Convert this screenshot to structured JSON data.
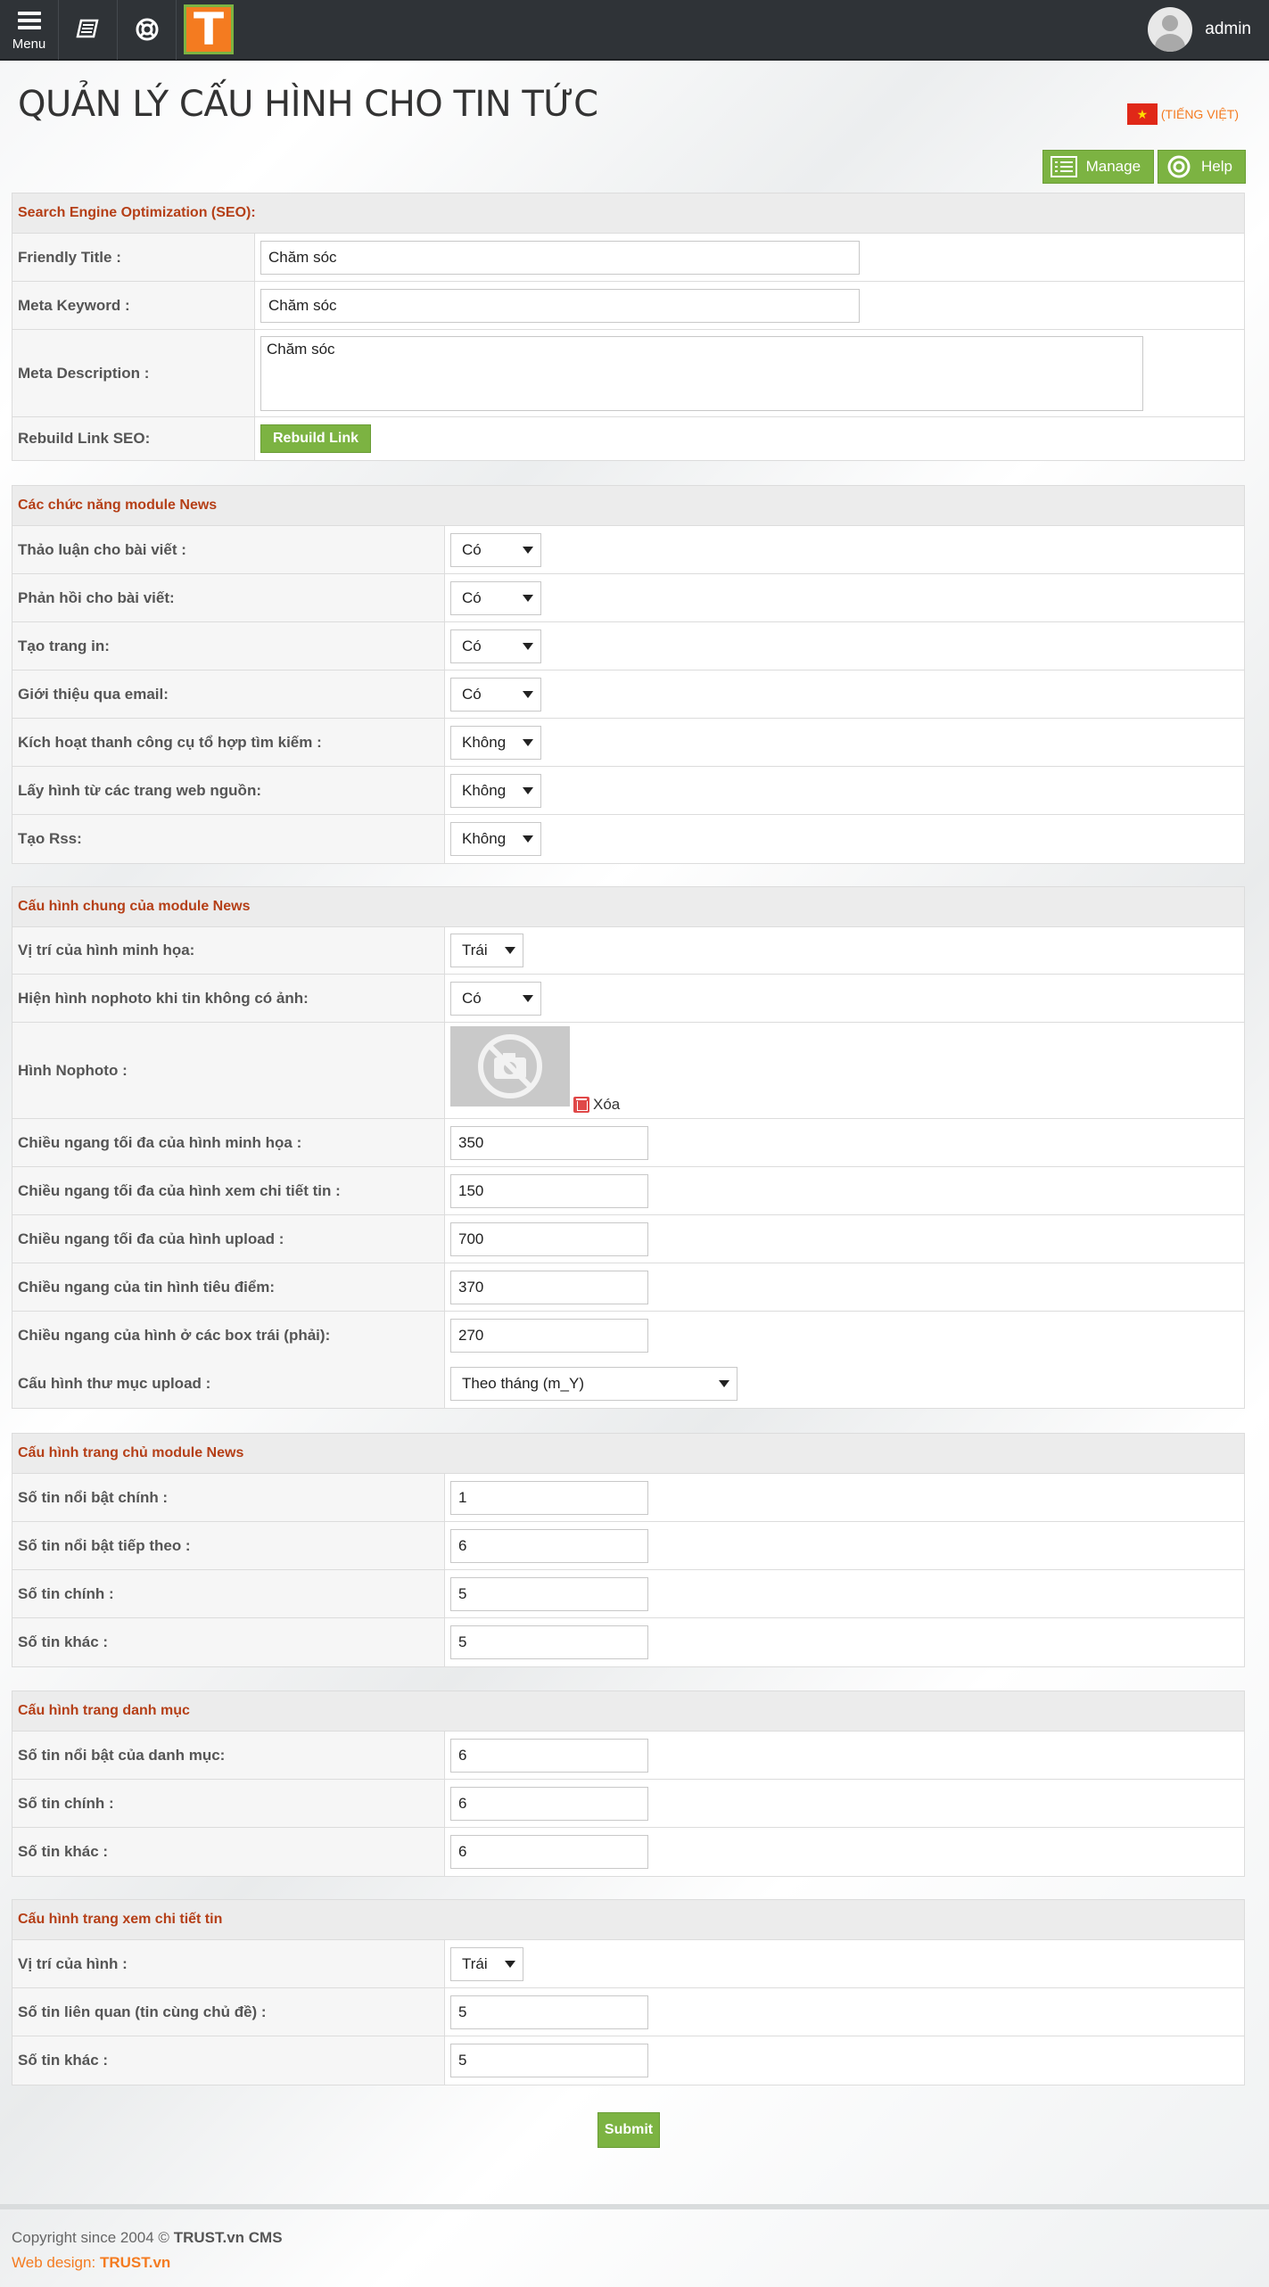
{
  "topbar": {
    "menu_label": "Menu",
    "logo_letter": "T",
    "username": "admin"
  },
  "page": {
    "title": "QUẢN LÝ CẤU HÌNH CHO TIN TỨC",
    "language": "(TIẾNG VIỆT)",
    "manage_label": "Manage",
    "help_label": "Help"
  },
  "seo": {
    "heading": "Search Engine Optimization (SEO):",
    "friendly_title_label": "Friendly Title :",
    "friendly_title_value": "Chăm sóc",
    "meta_keyword_label": "Meta Keyword :",
    "meta_keyword_value": "Chăm sóc",
    "meta_description_label": "Meta Description :",
    "meta_description_value": "Chăm sóc",
    "rebuild_label": "Rebuild Link SEO:",
    "rebuild_button": "Rebuild Link"
  },
  "functions": {
    "heading": "Các chức năng module News",
    "rows": [
      {
        "label": "Thảo luận cho bài viết :",
        "value": "Có"
      },
      {
        "label": "Phản hồi cho bài viết:",
        "value": "Có"
      },
      {
        "label": "Tạo trang in:",
        "value": "Có"
      },
      {
        "label": "Giới thiệu qua email:",
        "value": "Có"
      },
      {
        "label": "Kích hoạt thanh công cụ tổ hợp tìm kiếm :",
        "value": "Không"
      },
      {
        "label": "Lấy hình từ các trang web nguồn:",
        "value": "Không"
      },
      {
        "label": "Tạo Rss:",
        "value": "Không"
      }
    ]
  },
  "general": {
    "heading": "Cấu hình chung của module News",
    "image_position_label": "Vị trí của hình minh họa:",
    "image_position_value": "Trái",
    "show_nophoto_label": "Hiện hình nophoto khi tin không có ảnh:",
    "show_nophoto_value": "Có",
    "nophoto_label": "Hình Nophoto :",
    "delete_label": "Xóa",
    "inputs": [
      {
        "label": "Chiều ngang tối đa của hình minh họa :",
        "value": "350"
      },
      {
        "label": "Chiều ngang tối đa của hình xem chi tiết tin :",
        "value": "150"
      },
      {
        "label": "Chiều ngang tối đa của hình upload :",
        "value": "700"
      },
      {
        "label": "Chiều ngang của tin hình tiêu điểm:",
        "value": "370"
      },
      {
        "label": "Chiều ngang của hình ở các box trái (phải):",
        "value": "270"
      }
    ],
    "upload_folder_label": "Cấu hình thư mục upload :",
    "upload_folder_value": "Theo tháng (m_Y)"
  },
  "home": {
    "heading": "Cấu hình trang chủ module News",
    "rows": [
      {
        "label": "Số tin nổi bật chính :",
        "value": "1"
      },
      {
        "label": "Số tin nổi bật tiếp theo :",
        "value": "6"
      },
      {
        "label": "Số tin chính :",
        "value": "5"
      },
      {
        "label": "Số tin khác :",
        "value": "5"
      }
    ]
  },
  "category": {
    "heading": "Cấu hình trang danh mục",
    "rows": [
      {
        "label": "Số tin nổi bật của danh mục:",
        "value": "6"
      },
      {
        "label": "Số tin chính :",
        "value": "6"
      },
      {
        "label": "Số tin khác :",
        "value": "6"
      }
    ]
  },
  "detail": {
    "heading": "Cấu hình trang xem chi tiết tin",
    "image_position_label": "Vị trí của hình :",
    "image_position_value": "Trái",
    "rows": [
      {
        "label": "Số tin liên quan (tin cùng chủ đề) :",
        "value": "5"
      },
      {
        "label": "Số tin khác :",
        "value": "5"
      }
    ]
  },
  "submit_label": "Submit",
  "footer": {
    "copyright_prefix": "Copyright since 2004 ©",
    "copyright_brand": "TRUST.vn CMS",
    "webdesign_prefix": "Web design:",
    "webdesign_brand": "TRUST.vn"
  }
}
